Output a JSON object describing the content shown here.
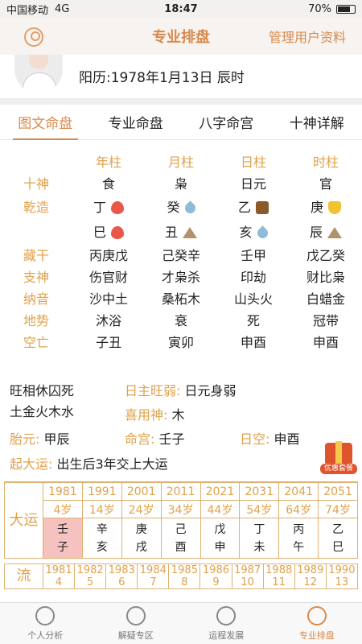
{
  "status": {
    "carrier": "中国移动",
    "network": "4G",
    "time": "18:47",
    "battery": "70%"
  },
  "nav": {
    "title": "专业排盘",
    "manage": "管理用户资料"
  },
  "profile": {
    "date": "阳历:1978年1月13日 辰时"
  },
  "tabs": [
    "图文命盘",
    "专业命盘",
    "八字命宫",
    "十神详解"
  ],
  "pillars": {
    "headers": [
      "年柱",
      "月柱",
      "日柱",
      "时柱"
    ],
    "rows": [
      {
        "label": "十神",
        "values": [
          "食",
          "枭",
          "日元",
          "官"
        ]
      },
      {
        "label": "乾造",
        "values": [
          "丁",
          "癸",
          "乙",
          "庚"
        ],
        "icons": [
          "fire-icon",
          "water-icon",
          "wood-icon",
          "metal-icon"
        ]
      },
      {
        "label": "",
        "values": [
          "巳",
          "丑",
          "亥",
          "辰"
        ],
        "icons": [
          "fire-icon",
          "earth-icon",
          "water-icon",
          "earth-icon"
        ]
      },
      {
        "label": "藏干",
        "values": [
          "丙庚戊",
          "己癸辛",
          "壬甲",
          "戊乙癸"
        ]
      },
      {
        "label": "支神",
        "values": [
          "伤官财",
          "才枭杀",
          "印劫",
          "财比枭"
        ]
      },
      {
        "label": "纳音",
        "values": [
          "沙中土",
          "桑柘木",
          "山头火",
          "白蜡金"
        ]
      },
      {
        "label": "地势",
        "values": [
          "沐浴",
          "衰",
          "死",
          "冠带"
        ]
      },
      {
        "label": "空亡",
        "values": [
          "子丑",
          "寅卯",
          "申酉",
          "申酉"
        ]
      }
    ]
  },
  "info": {
    "wangxiang_k": "旺相休囚死",
    "wangxiang_v": "土金火木水",
    "rizhu_k": "日主旺弱:",
    "rizhu_v": "日元身弱",
    "xiyong_k": "喜用神:",
    "xiyong_v": "木",
    "taiyuan_k": "胎元:",
    "taiyuan_v": "甲辰",
    "minggong_k": "命宫:",
    "minggong_v": "壬子",
    "rikong_k": "日空:",
    "rikong_v": "申酉",
    "qiyun_k": "起大运:",
    "qiyun_v": "出生后3年交上大运"
  },
  "gift": "优惠套餐",
  "dayun": {
    "side": "大运",
    "years": [
      "1981",
      "1991",
      "2001",
      "2011",
      "2021",
      "2031",
      "2041",
      "2051"
    ],
    "ages": [
      "4岁",
      "14岁",
      "24岁",
      "34岁",
      "44岁",
      "54岁",
      "64岁",
      "74岁"
    ],
    "top": [
      "壬",
      "辛",
      "庚",
      "己",
      "戊",
      "丁",
      "丙",
      "乙"
    ],
    "bottom": [
      "子",
      "亥",
      "戌",
      "酉",
      "申",
      "未",
      "午",
      "巳"
    ],
    "selected": 0
  },
  "liunian": {
    "side": "流",
    "years": [
      "1981",
      "1982",
      "1983",
      "1984",
      "1985",
      "1986",
      "1987",
      "1988",
      "1989",
      "1990"
    ],
    "ages": [
      "4",
      "5",
      "6",
      "7",
      "8",
      "9",
      "10",
      "11",
      "12",
      "13"
    ]
  },
  "bottom_nav": [
    "个人分析",
    "解疑专区",
    "运程发展",
    "专业排盘"
  ]
}
